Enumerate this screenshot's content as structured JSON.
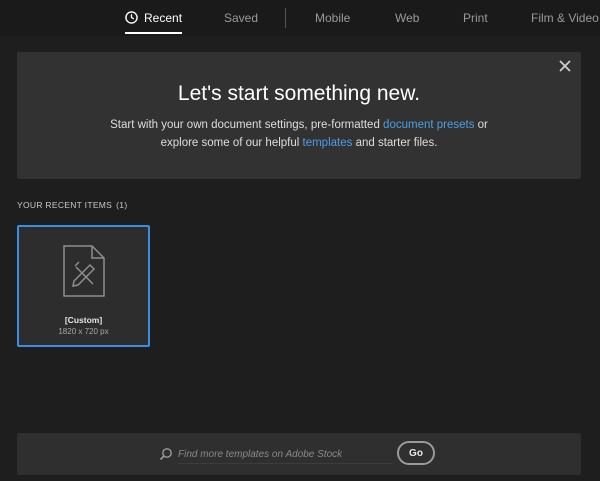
{
  "tabs": [
    {
      "label": "Recent",
      "active": true,
      "icon": "clock-icon"
    },
    {
      "label": "Saved",
      "active": false
    },
    {
      "label": "Mobile",
      "active": false
    },
    {
      "label": "Web",
      "active": false
    },
    {
      "label": "Print",
      "active": false
    },
    {
      "label": "Film & Video",
      "active": false
    }
  ],
  "hero": {
    "title": "Let's start something new.",
    "line1_before": "Start with your own document settings, pre-formatted ",
    "line1_link": "document presets",
    "line1_after": " or",
    "line2_before": "explore some of our helpful ",
    "line2_link": "templates",
    "line2_after": " and starter files.",
    "close_icon": "close-icon"
  },
  "recent": {
    "heading": "YOUR RECENT ITEMS",
    "count": "(1)",
    "items": [
      {
        "name": "[Custom]",
        "size": "1820 x 720 px",
        "icon": "document-edit-icon"
      }
    ]
  },
  "search": {
    "placeholder": "Find more templates on Adobe Stock",
    "go_label": "Go",
    "icon": "search-icon"
  },
  "colors": {
    "background": "#1e1e1e",
    "panel": "#323232",
    "accent": "#3a8ee6",
    "link": "#4d9ee8"
  }
}
